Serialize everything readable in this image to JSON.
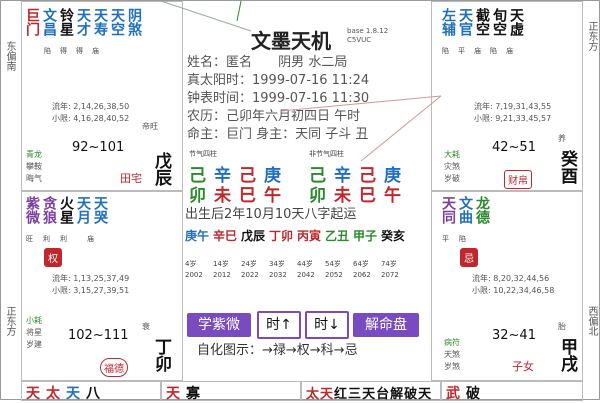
{
  "app": {
    "title": "文墨天机",
    "version": "base 1.8.12",
    "code": "C5VUC"
  },
  "sides": {
    "left_top": "东偏南",
    "left_bottom": "正东方",
    "right_top": "正东方",
    "right_bottom": "西偏北"
  },
  "colors": {
    "green": "#2b8a2b",
    "blue": "#1f6fbf",
    "red": "#c0272d",
    "purple": "#7a4bc0"
  },
  "info": {
    "name_label": "姓名：",
    "name": "匿名",
    "gender": "阴男",
    "bureau": "水二局",
    "true_solar": "真太阳时：1999-07-16 11:24",
    "clock_time": "钟表时间：1999-07-16 11:30",
    "lunar": "农历：己卯年六月初四日 午时",
    "life": "命主：巨门 身主：天同 子斗 丑"
  },
  "bazi": {
    "left_label": "节气四柱",
    "right_label": "非节气四柱",
    "left_stems": [
      "己",
      "辛",
      "己",
      "庚"
    ],
    "left_branches": [
      "卯",
      "未",
      "巳",
      "午"
    ],
    "right_stems": [
      "己",
      "辛",
      "己",
      "庚"
    ],
    "right_branches": [
      "卯",
      "未",
      "巳",
      "午"
    ],
    "yun_text": "出生后2年10月10天八字起运",
    "dayun_top": [
      "庚午",
      "辛巳",
      "戊辰",
      "丁卯",
      "丙寅",
      "乙丑",
      "甲子",
      "癸亥"
    ],
    "dayun_ages": [
      "4岁",
      "14岁",
      "24岁",
      "34岁",
      "44岁",
      "54岁",
      "64岁",
      "74岁"
    ],
    "dayun_years": [
      "2002",
      "2012",
      "2022",
      "2032",
      "2042",
      "2052",
      "2062",
      "2072"
    ]
  },
  "buttons": {
    "ziwei": "学紫微",
    "time_up": "时↑",
    "time_down": "时↓",
    "jieming": "解命盘"
  },
  "legend": "自化图示：→禄→权→科→忌",
  "palaces": {
    "tl": {
      "stars_big": [
        "巨门",
        "文昌",
        "铃星",
        "天才",
        "天寿",
        "天空",
        "阴煞"
      ],
      "status": [
        "陷",
        "得",
        "得",
        "庙",
        "",
        "",
        ""
      ],
      "liunian": "流年: 2,14,26,38,50",
      "xiaoxian": "小限: 4,16,28,40,52",
      "range": "92~101",
      "changsheng": "帝旺",
      "small_stars": [
        "青龙",
        "攀鞍",
        "晦气"
      ],
      "palace": "田宅",
      "branch": "戊辰"
    },
    "tr": {
      "stars_big": [
        "左辅",
        "天官",
        "截空",
        "旬空",
        "天虚"
      ],
      "status": [
        "陷",
        "平",
        "庙",
        "陷",
        "庙"
      ],
      "liunian": "流年: 7,19,31,43,55",
      "xiaoxian": "小限: 9,21,33,45,57",
      "range": "42~51",
      "changsheng": "养",
      "small_stars": [
        "大耗",
        "灾煞",
        "岁破"
      ],
      "palace": "财帛",
      "branch": "癸酉"
    },
    "ml": {
      "stars_big": [
        "紫微",
        "贪狼",
        "火星",
        "天月",
        "天哭"
      ],
      "status": [
        "旺",
        "利",
        "利",
        "",
        "庙"
      ],
      "hua": "权",
      "liunian": "流年: 1,13,25,37,49",
      "xiaoxian": "小限: 3,15,27,39,51",
      "range": "102~111",
      "changsheng": "衰",
      "small_stars": [
        "小耗",
        "将星",
        "岁建"
      ],
      "palace": "福德",
      "branch": "丁卯"
    },
    "mr": {
      "stars_big": [
        "天同",
        "文曲",
        "龙德"
      ],
      "status": [
        "平",
        "陷",
        ""
      ],
      "hua": "忌",
      "liunian": "流年: 8,20,32,44,56",
      "xiaoxian": "小限: 10,22,34,46,58",
      "range": "32~41",
      "changsheng": "胎",
      "small_stars": [
        "病符",
        "天煞",
        "岁煞"
      ],
      "palace": "子女",
      "branch": "甲戌"
    },
    "bl": {
      "stars_big": [
        "天",
        "太",
        "天",
        "八"
      ]
    },
    "bc1": {
      "stars_big": [
        "天",
        "寡"
      ]
    },
    "bc2": {
      "stars_big": [
        "太",
        "天",
        "红",
        "三",
        "天",
        "台",
        "解",
        "破",
        "天"
      ]
    },
    "br": {
      "stars_big": [
        "武",
        "破"
      ]
    }
  }
}
